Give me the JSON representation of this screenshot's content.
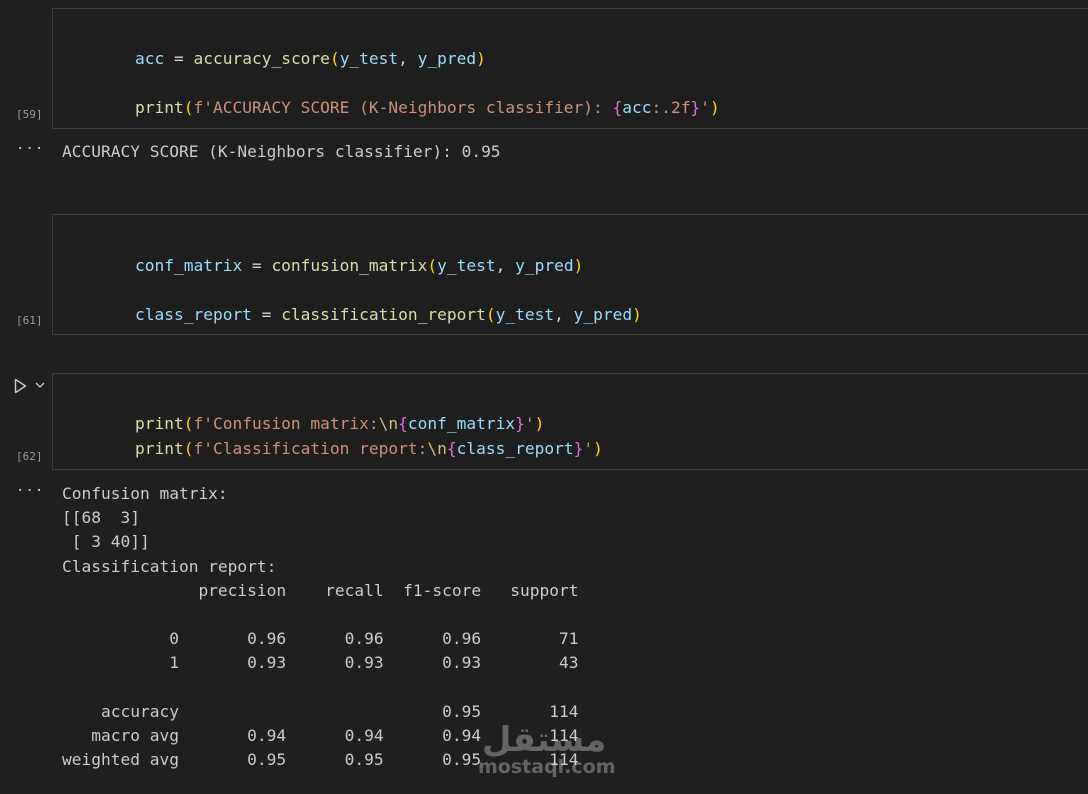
{
  "cells": [
    {
      "exec_count": "[59]",
      "lines": [
        [
          "acc",
          " = ",
          "accuracy_score",
          "(",
          "y_test",
          ", ",
          "y_pred",
          ")"
        ],
        [
          "print",
          "(",
          "f'ACCURACY SCORE (K-Neighbors classifier): ",
          "{",
          "acc",
          ":.2f",
          "}",
          "'",
          ")"
        ]
      ]
    },
    {
      "exec_count": "[61]",
      "lines": [
        [
          "conf_matrix",
          " = ",
          "confusion_matrix",
          "(",
          "y_test",
          ", ",
          "y_pred",
          ")"
        ],
        [
          "class_report",
          " = ",
          "classification_report",
          "(",
          "y_test",
          ", ",
          "y_pred",
          ")"
        ]
      ]
    },
    {
      "exec_count": "[62]",
      "lines": [
        [
          "print",
          "(",
          "f'Confusion matrix:",
          "\\n",
          "{",
          "conf_matrix",
          "}",
          "'",
          ")"
        ],
        [
          "print",
          "(",
          "f'Classification report:",
          "\\n",
          "{",
          "class_report",
          "}",
          "'",
          ")"
        ]
      ]
    }
  ],
  "outputs": {
    "ellipsis": "···",
    "accuracy_output": "ACCURACY SCORE (K-Neighbors classifier): 0.95",
    "report_output": [
      "Confusion matrix:",
      "[[68  3]",
      " [ 3 40]]",
      "Classification report:",
      "              precision    recall  f1-score   support",
      "",
      "           0       0.96      0.96      0.96        71",
      "           1       0.93      0.93      0.93        43",
      "",
      "    accuracy                           0.95       114",
      "   macro avg       0.94      0.94      0.94       114",
      "weighted avg       0.95      0.95      0.95       114"
    ]
  },
  "watermark": {
    "arabic": "مستقل",
    "latin": "mostaql.com"
  },
  "icons": {
    "run": "play-icon",
    "expand": "chevron-down-icon",
    "more": "ellipsis-icon"
  }
}
